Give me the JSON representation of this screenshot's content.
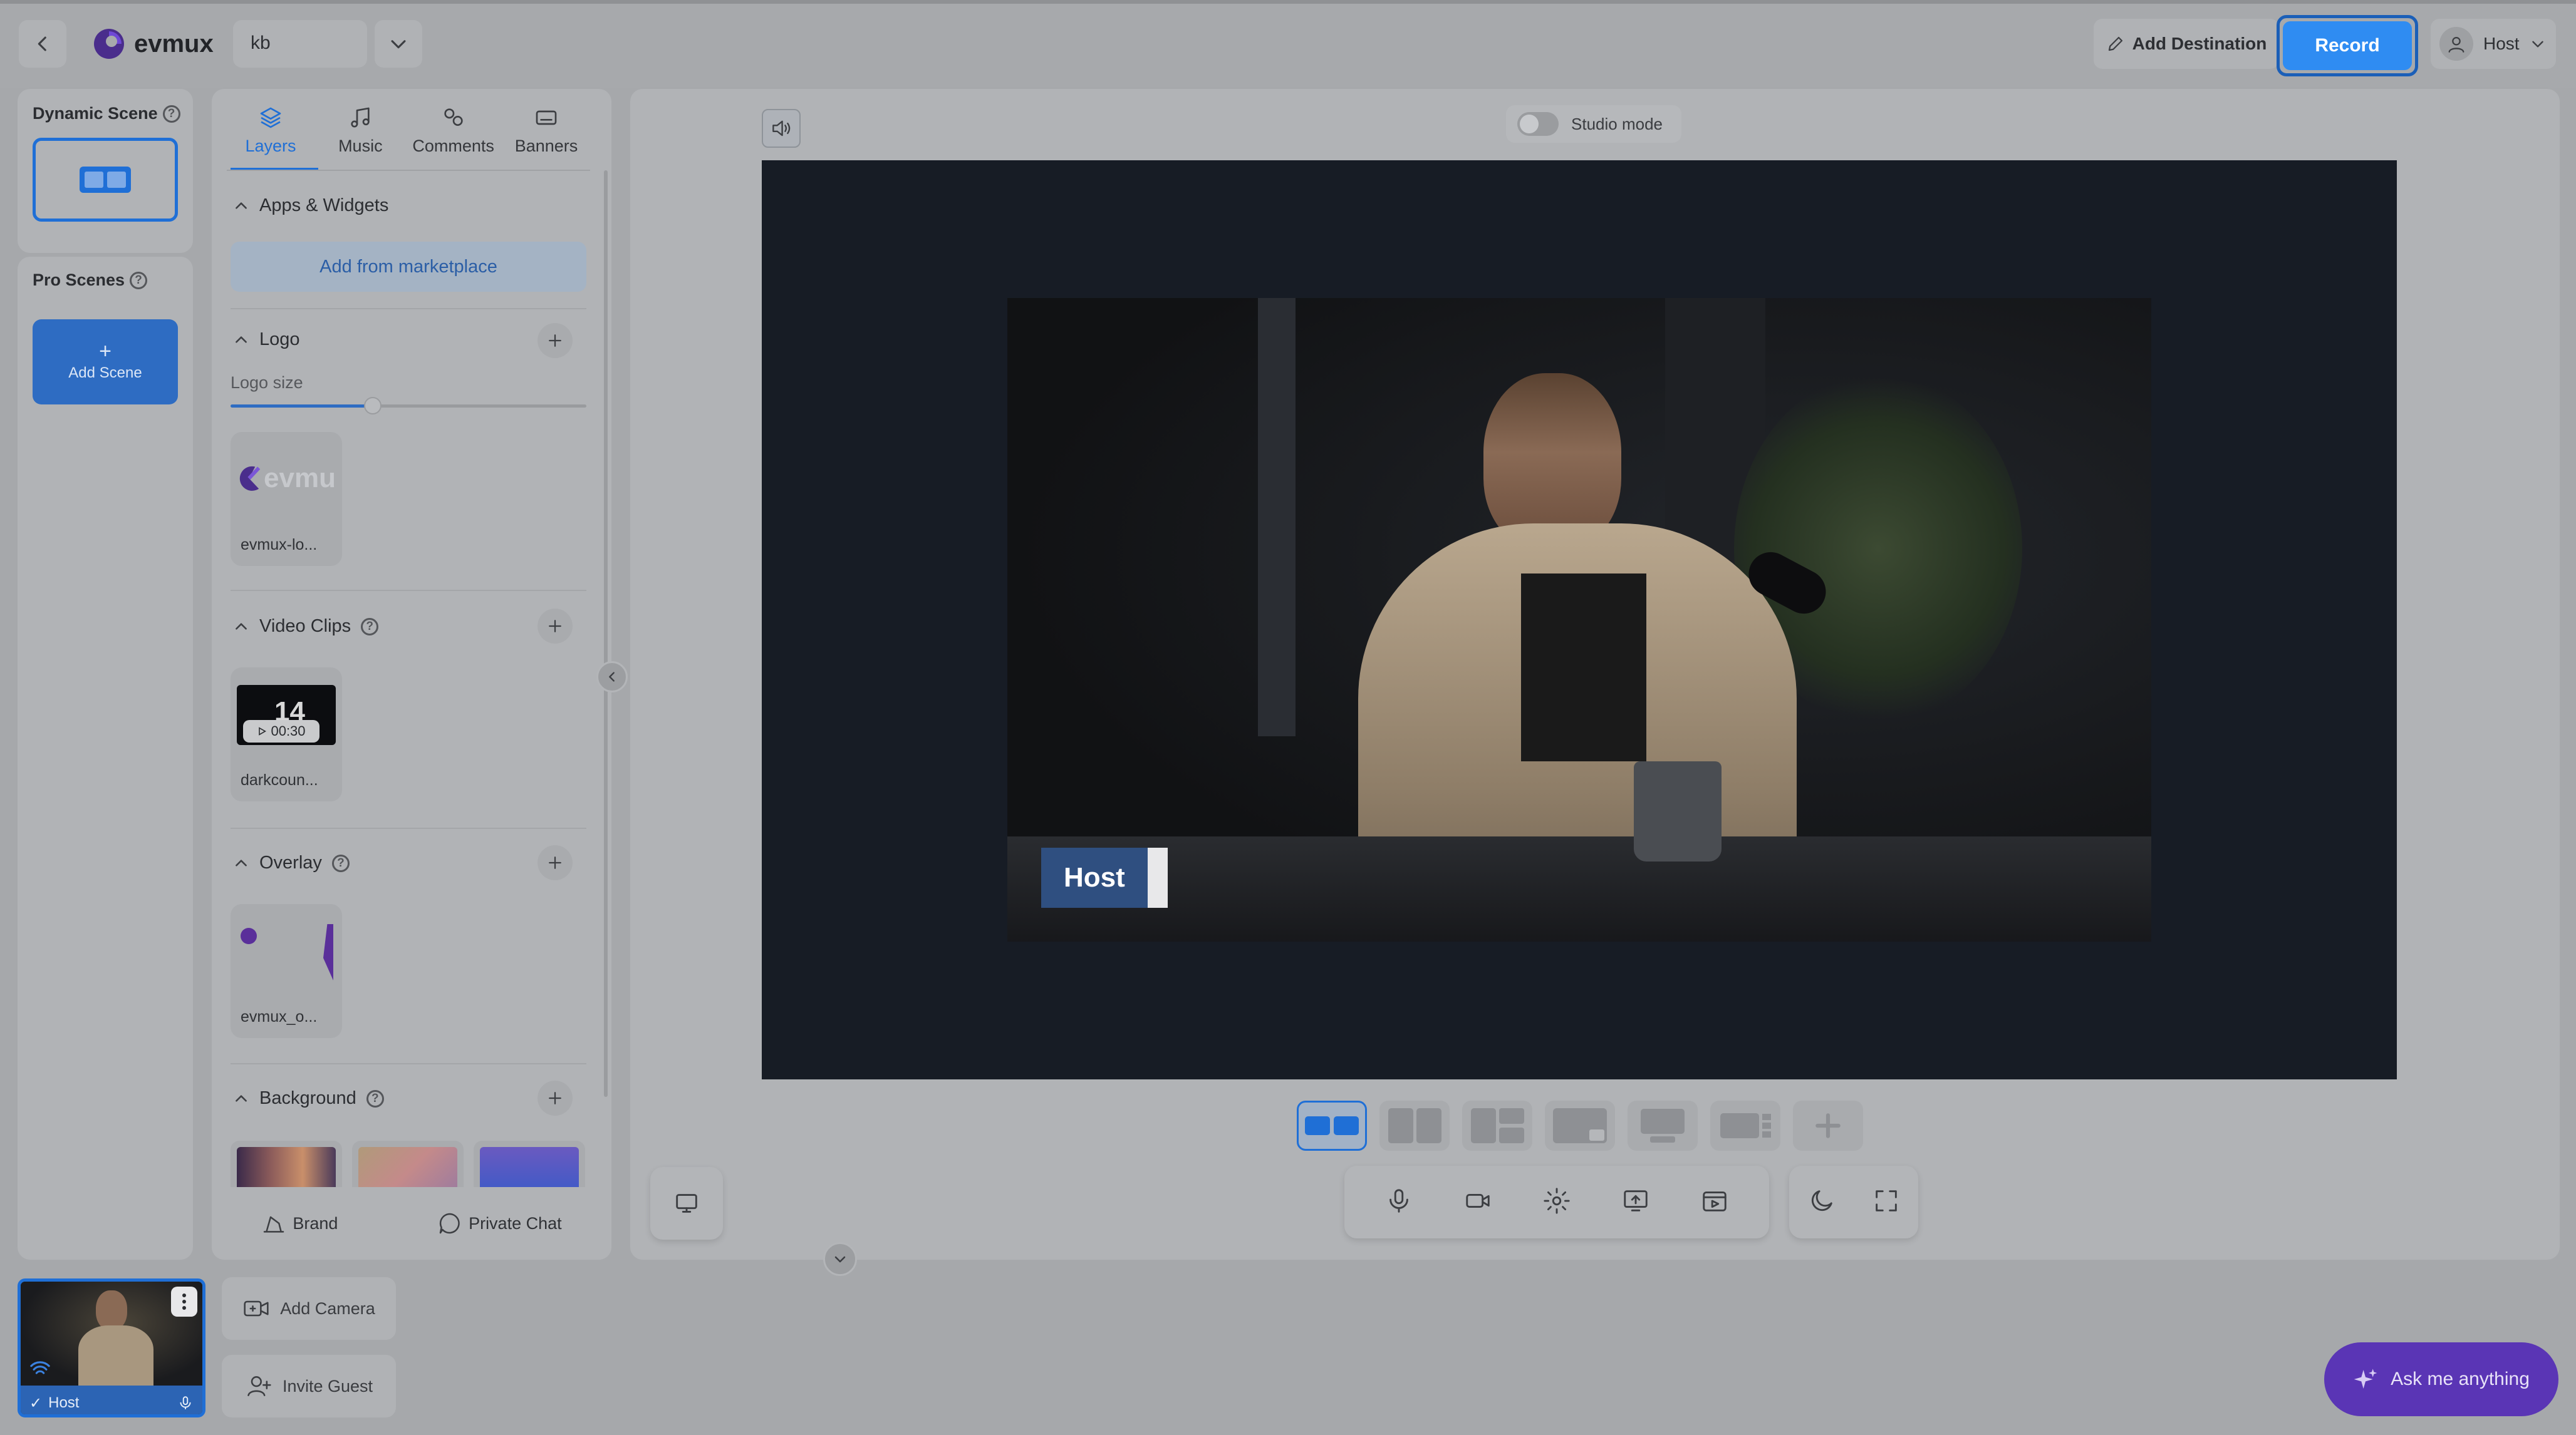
{
  "app": {
    "logo_text": "evmux"
  },
  "topbar": {
    "room_name": "kb",
    "add_destination_label": "Add Destination",
    "record_label": "Record",
    "user_label": "Host"
  },
  "scenes": {
    "dynamic_title": "Dynamic Scene",
    "pro_title": "Pro Scenes",
    "add_scene_label": "Add Scene"
  },
  "tabs": [
    {
      "label": "Layers",
      "icon": "layers-icon"
    },
    {
      "label": "Music",
      "icon": "music-icon"
    },
    {
      "label": "Comments",
      "icon": "comments-icon"
    },
    {
      "label": "Banners",
      "icon": "banners-icon"
    }
  ],
  "layers": {
    "apps_title": "Apps & Widgets",
    "marketplace_label": "Add from marketplace",
    "logo_title": "Logo",
    "logo_size_label": "Logo size",
    "logo_size_value": 0.4,
    "logo_card_label": "evmux-lo...",
    "logo_card_text": "evmu",
    "video_clips_title": "Video Clips",
    "video_card_label": "darkcoun...",
    "video_duration": "00:30",
    "video_thumb_text": "14",
    "overlay_title": "Overlay",
    "overlay_card_label": "evmux_o...",
    "background_title": "Background"
  },
  "panel_footer": {
    "brand_label": "Brand",
    "chat_label": "Private Chat"
  },
  "stage": {
    "studio_mode_label": "Studio mode",
    "name_tag": "Host"
  },
  "participants": {
    "host_label": "Host",
    "add_camera_label": "Add Camera",
    "invite_guest_label": "Invite Guest"
  },
  "assistant": {
    "label": "Ask me anything"
  },
  "colors": {
    "accent": "#1f6fd6",
    "record": "#2f8cf2",
    "assistant": "#5a35b5",
    "name_tag": "#2f4f80"
  }
}
